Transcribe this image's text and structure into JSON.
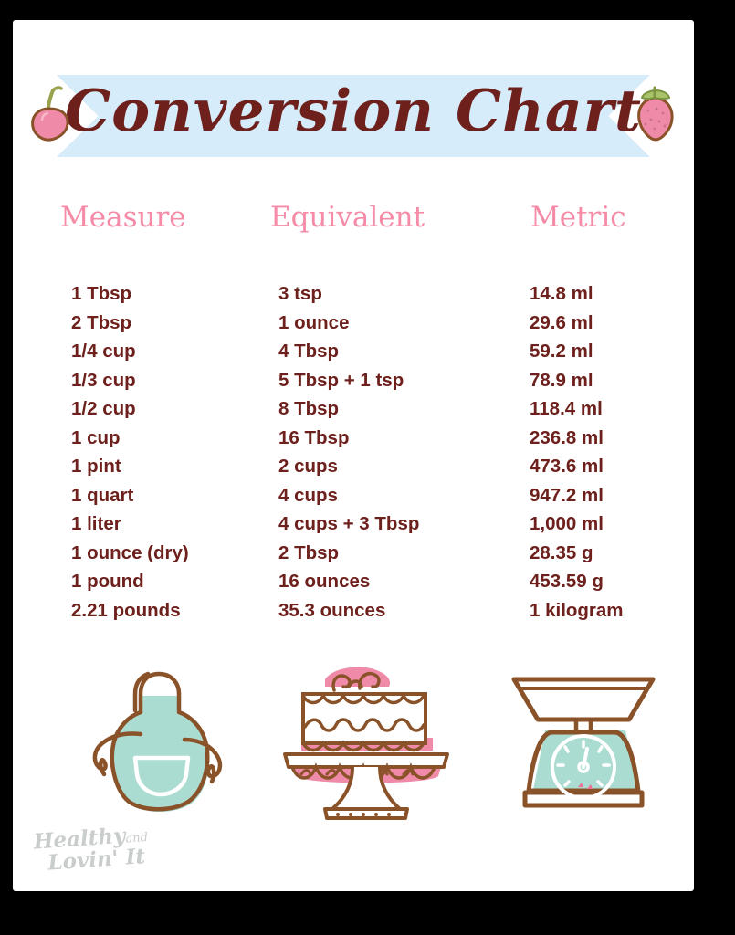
{
  "banner": {
    "title": "Conversion Chart",
    "left_fruit_icon": "cherry-icon",
    "right_fruit_icon": "strawberry-icon",
    "ribbon_color": "#d7ecfa",
    "title_color": "#6d201c"
  },
  "headers": {
    "measure": "Measure",
    "equivalent": "Equivalent",
    "metric": "Metric",
    "color": "#f58ba7"
  },
  "table": {
    "columns": [
      "Measure",
      "Equivalent",
      "Metric"
    ],
    "text_color": "#6d201c",
    "rows": [
      [
        "1 Tbsp",
        "3 tsp",
        "14.8 ml"
      ],
      [
        "2 Tbsp",
        "1 ounce",
        "29.6 ml"
      ],
      [
        "1/4 cup",
        "4 Tbsp",
        "59.2 ml"
      ],
      [
        "1/3 cup",
        "5 Tbsp + 1 tsp",
        "78.9 ml"
      ],
      [
        "1/2 cup",
        "8 Tbsp",
        "118.4 ml"
      ],
      [
        "1 cup",
        "16 Tbsp",
        "236.8 ml"
      ],
      [
        "1 pint",
        "2 cups",
        "473.6 ml"
      ],
      [
        "1 quart",
        "4 cups",
        "947.2 ml"
      ],
      [
        "1 liter",
        "4 cups + 3 Tbsp",
        "1,000 ml"
      ],
      [
        "1 ounce (dry)",
        "2 Tbsp",
        "28.35 g"
      ],
      [
        "1 pound",
        "16 ounces",
        "453.59 g"
      ],
      [
        "2.21 pounds",
        "35.3 ounces",
        "1 kilogram"
      ]
    ]
  },
  "illustrations": [
    {
      "name": "apron-illustration",
      "label": "apron"
    },
    {
      "name": "cake-illustration",
      "label": "layer cake on stand"
    },
    {
      "name": "scale-illustration",
      "label": "kitchen scale"
    }
  ],
  "watermark": {
    "line1": "Healthy",
    "and": "and",
    "line2": "Lovin' It",
    "color": "#c9cdcb"
  },
  "palette": {
    "page_background": "#ffffff",
    "outer_background": "#000000",
    "mint": "#abdcd2",
    "pink": "#ef8aa8",
    "brown": "#8a5228",
    "dark_brown": "#6d201c"
  }
}
